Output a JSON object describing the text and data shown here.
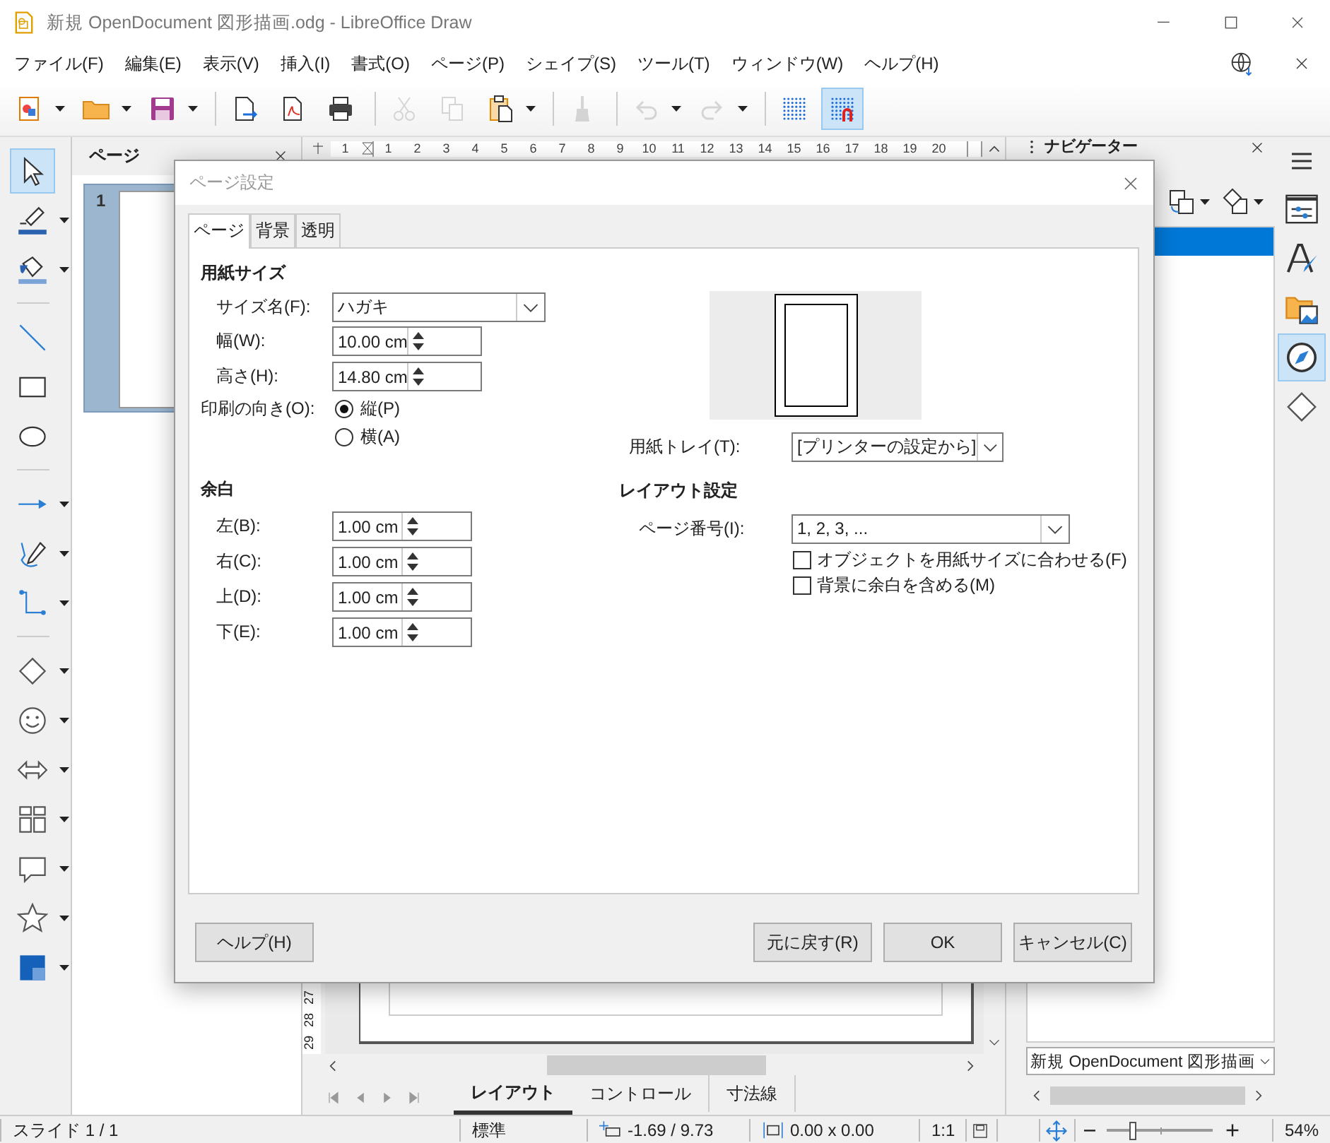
{
  "window": {
    "title": "新規 OpenDocument 図形描画.odg - LibreOffice Draw"
  },
  "menu": [
    "ファイル(F)",
    "編集(E)",
    "表示(V)",
    "挿入(I)",
    "書式(O)",
    "ページ(P)",
    "シェイプ(S)",
    "ツール(T)",
    "ウィンドウ(W)",
    "ヘルプ(H)"
  ],
  "toolbar": [
    {
      "kind": "template",
      "dropdown": true,
      "disabled": false,
      "selected": false
    },
    {
      "kind": "open",
      "dropdown": true,
      "disabled": false,
      "selected": false
    },
    {
      "kind": "save",
      "dropdown": true,
      "disabled": false,
      "selected": false
    },
    {
      "kind": "separator"
    },
    {
      "kind": "export",
      "dropdown": false,
      "disabled": false,
      "selected": false
    },
    {
      "kind": "pdf",
      "dropdown": false,
      "disabled": false,
      "selected": false
    },
    {
      "kind": "print",
      "dropdown": false,
      "disabled": false,
      "selected": false
    },
    {
      "kind": "separator"
    },
    {
      "kind": "cut",
      "dropdown": false,
      "disabled": true,
      "selected": false
    },
    {
      "kind": "copy",
      "dropdown": false,
      "disabled": true,
      "selected": false
    },
    {
      "kind": "paste",
      "dropdown": true,
      "disabled": false,
      "selected": false
    },
    {
      "kind": "separator"
    },
    {
      "kind": "clone",
      "dropdown": false,
      "disabled": true,
      "selected": false
    },
    {
      "kind": "separator"
    },
    {
      "kind": "undo",
      "dropdown": true,
      "disabled": true,
      "selected": false
    },
    {
      "kind": "redo",
      "dropdown": true,
      "disabled": true,
      "selected": false
    },
    {
      "kind": "separator"
    },
    {
      "kind": "grid",
      "dropdown": false,
      "disabled": false,
      "selected": false
    },
    {
      "kind": "snap",
      "dropdown": false,
      "disabled": false,
      "selected": true
    }
  ],
  "tools": [
    {
      "kind": "select",
      "dropdown": false,
      "selected": true
    },
    {
      "kind": "linecolor",
      "dropdown": true,
      "selected": false
    },
    {
      "kind": "fillcolor",
      "dropdown": true,
      "selected": false
    },
    {
      "kind": "separator"
    },
    {
      "kind": "line",
      "dropdown": false,
      "selected": false
    },
    {
      "kind": "rect",
      "dropdown": false,
      "selected": false
    },
    {
      "kind": "ellipse",
      "dropdown": false,
      "selected": false
    },
    {
      "kind": "separator"
    },
    {
      "kind": "arrowline",
      "dropdown": true,
      "selected": false
    },
    {
      "kind": "curve",
      "dropdown": true,
      "selected": false
    },
    {
      "kind": "connector",
      "dropdown": true,
      "selected": false
    },
    {
      "kind": "separator"
    },
    {
      "kind": "diamond",
      "dropdown": true,
      "selected": false
    },
    {
      "kind": "smiley",
      "dropdown": true,
      "selected": false
    },
    {
      "kind": "blockarrow",
      "dropdown": true,
      "selected": false
    },
    {
      "kind": "flowchart",
      "dropdown": true,
      "selected": false
    },
    {
      "kind": "callout",
      "dropdown": true,
      "selected": false
    },
    {
      "kind": "star",
      "dropdown": true,
      "selected": false
    },
    {
      "kind": "cube",
      "dropdown": true,
      "selected": false
    }
  ],
  "pages_panel": {
    "title": "ページ",
    "slides": [
      {
        "number": "1",
        "selected": true
      }
    ]
  },
  "ruler": {
    "left_of_origin": [
      "1"
    ],
    "right_of_origin": [
      "1",
      "2",
      "3",
      "4",
      "5",
      "6",
      "7",
      "8",
      "9",
      "10",
      "11",
      "12",
      "13",
      "14",
      "15",
      "16",
      "17",
      "18",
      "19",
      "20"
    ],
    "vertical": [
      "27",
      "28",
      "29"
    ]
  },
  "sheet_tabs": [
    {
      "label": "レイアウト",
      "selected": true
    },
    {
      "label": "コントロール",
      "selected": false
    },
    {
      "label": "寸法線",
      "selected": false
    }
  ],
  "navigator": {
    "title": "ナビゲーター",
    "document": "新規 OpenDocument 図形描画"
  },
  "sidebar_tabs": [
    {
      "kind": "properties",
      "selected": false
    },
    {
      "kind": "styles",
      "selected": false
    },
    {
      "kind": "gallery",
      "selected": false
    },
    {
      "kind": "navigator",
      "selected": true
    },
    {
      "kind": "shapes",
      "selected": false
    }
  ],
  "status_bar": {
    "slide": "スライド 1 / 1",
    "layout": "標準",
    "position": "-1.69 / 9.73",
    "size": "0.00 x 0.00",
    "scale": "1:1",
    "zoom_slider": {
      "level": 0.23
    },
    "zoom": "54%"
  },
  "dialog": {
    "title": "ページ設定",
    "tabs": [
      {
        "label": "ページ",
        "selected": true
      },
      {
        "label": "背景",
        "selected": false
      },
      {
        "label": "透明",
        "selected": false
      }
    ],
    "paper": {
      "heading": "用紙サイズ",
      "fields": [
        {
          "kind": "combo",
          "label": "サイズ名(F):",
          "value": "ハガキ"
        },
        {
          "kind": "spin",
          "label": "幅(W):",
          "value": "10.00 cm"
        },
        {
          "kind": "spin",
          "label": "高さ(H):",
          "value": "14.80 cm"
        }
      ],
      "orientation": {
        "label": "印刷の向き(O):",
        "options": [
          {
            "label": "縦(P)",
            "selected": true
          },
          {
            "label": "横(A)",
            "selected": false
          }
        ]
      },
      "tray": {
        "label": "用紙トレイ(T):",
        "value": "[プリンターの設定から]"
      }
    },
    "margins": {
      "heading": "余白",
      "fields": [
        {
          "label": "左(B):",
          "value": "1.00 cm"
        },
        {
          "label": "右(C):",
          "value": "1.00 cm"
        },
        {
          "label": "上(D):",
          "value": "1.00 cm"
        },
        {
          "label": "下(E):",
          "value": "1.00 cm"
        }
      ]
    },
    "layout": {
      "heading": "レイアウト設定",
      "page_number": {
        "label": "ページ番号(I):",
        "value": "1, 2, 3, ..."
      },
      "options": [
        {
          "label": "オブジェクトを用紙サイズに合わせる(F)",
          "checked": false
        },
        {
          "label": "背景に余白を含める(M)",
          "checked": false
        }
      ]
    },
    "buttons": [
      {
        "kind": "help",
        "label": "ヘルプ(H)"
      },
      {
        "kind": "reset",
        "label": "元に戻す(R)"
      },
      {
        "kind": "ok",
        "label": "OK"
      },
      {
        "kind": "cancel",
        "label": "キャンセル(C)"
      }
    ]
  }
}
